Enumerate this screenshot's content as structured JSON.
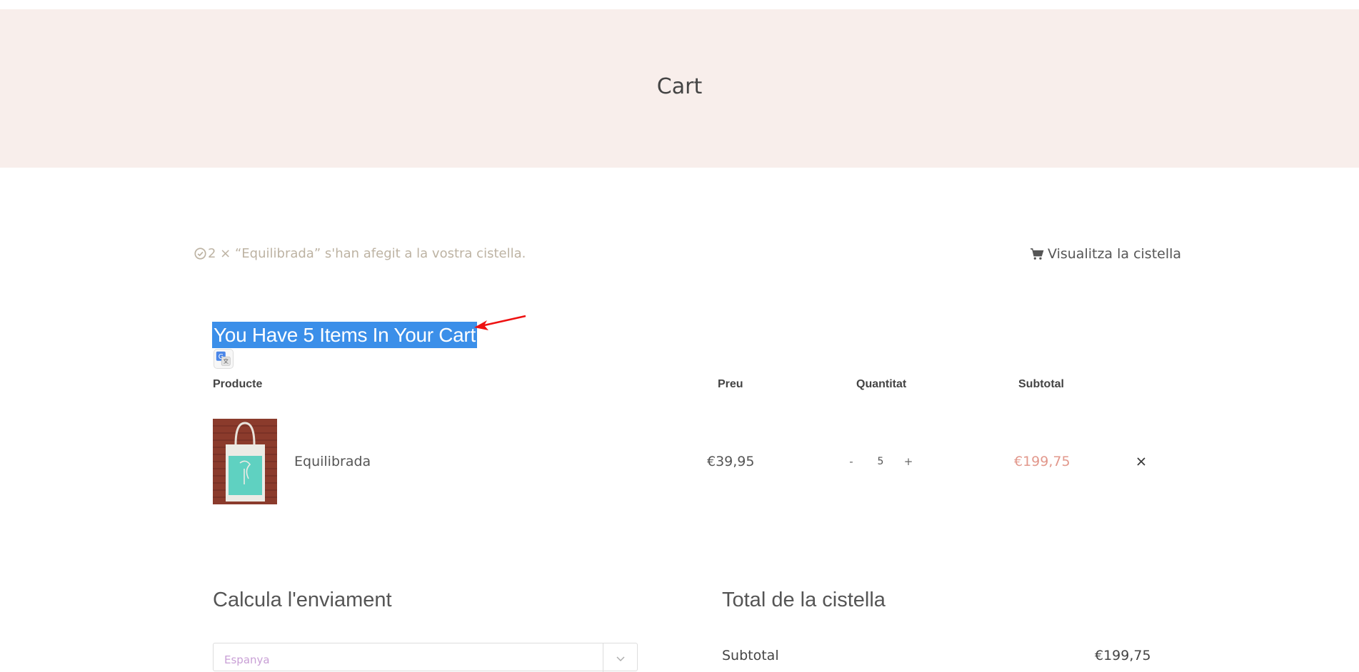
{
  "hero": {
    "title": "Cart"
  },
  "notice": {
    "message": "2 × “Equilibrada” s'han afegit a la vostra cistella.",
    "icon": "check-circle-icon",
    "view_cart_label": "Visualitza la cistella",
    "view_cart_icon": "shopping-cart-icon"
  },
  "cart": {
    "heading": "You Have 5 Items In Your Cart",
    "columns": {
      "product": "Producte",
      "price": "Preu",
      "quantity": "Quantitat",
      "subtotal": "Subtotal"
    },
    "items": [
      {
        "name": "Equilibrada",
        "price": "€39,95",
        "quantity": "5",
        "qty_minus": "-",
        "qty_plus": "+",
        "subtotal": "€199,75"
      }
    ]
  },
  "shipping": {
    "heading": "Calcula l'enviament",
    "country": "Espanya"
  },
  "totals": {
    "heading": "Total de la cistella",
    "subtotal_label": "Subtotal",
    "subtotal_value": "€199,75"
  },
  "colors": {
    "hero_bg": "#f8eeeb",
    "selection": "#3b8fe9",
    "price_accent": "#e2988c",
    "notice_text": "#bdb3a3",
    "annotation_arrow": "#ee1111"
  }
}
